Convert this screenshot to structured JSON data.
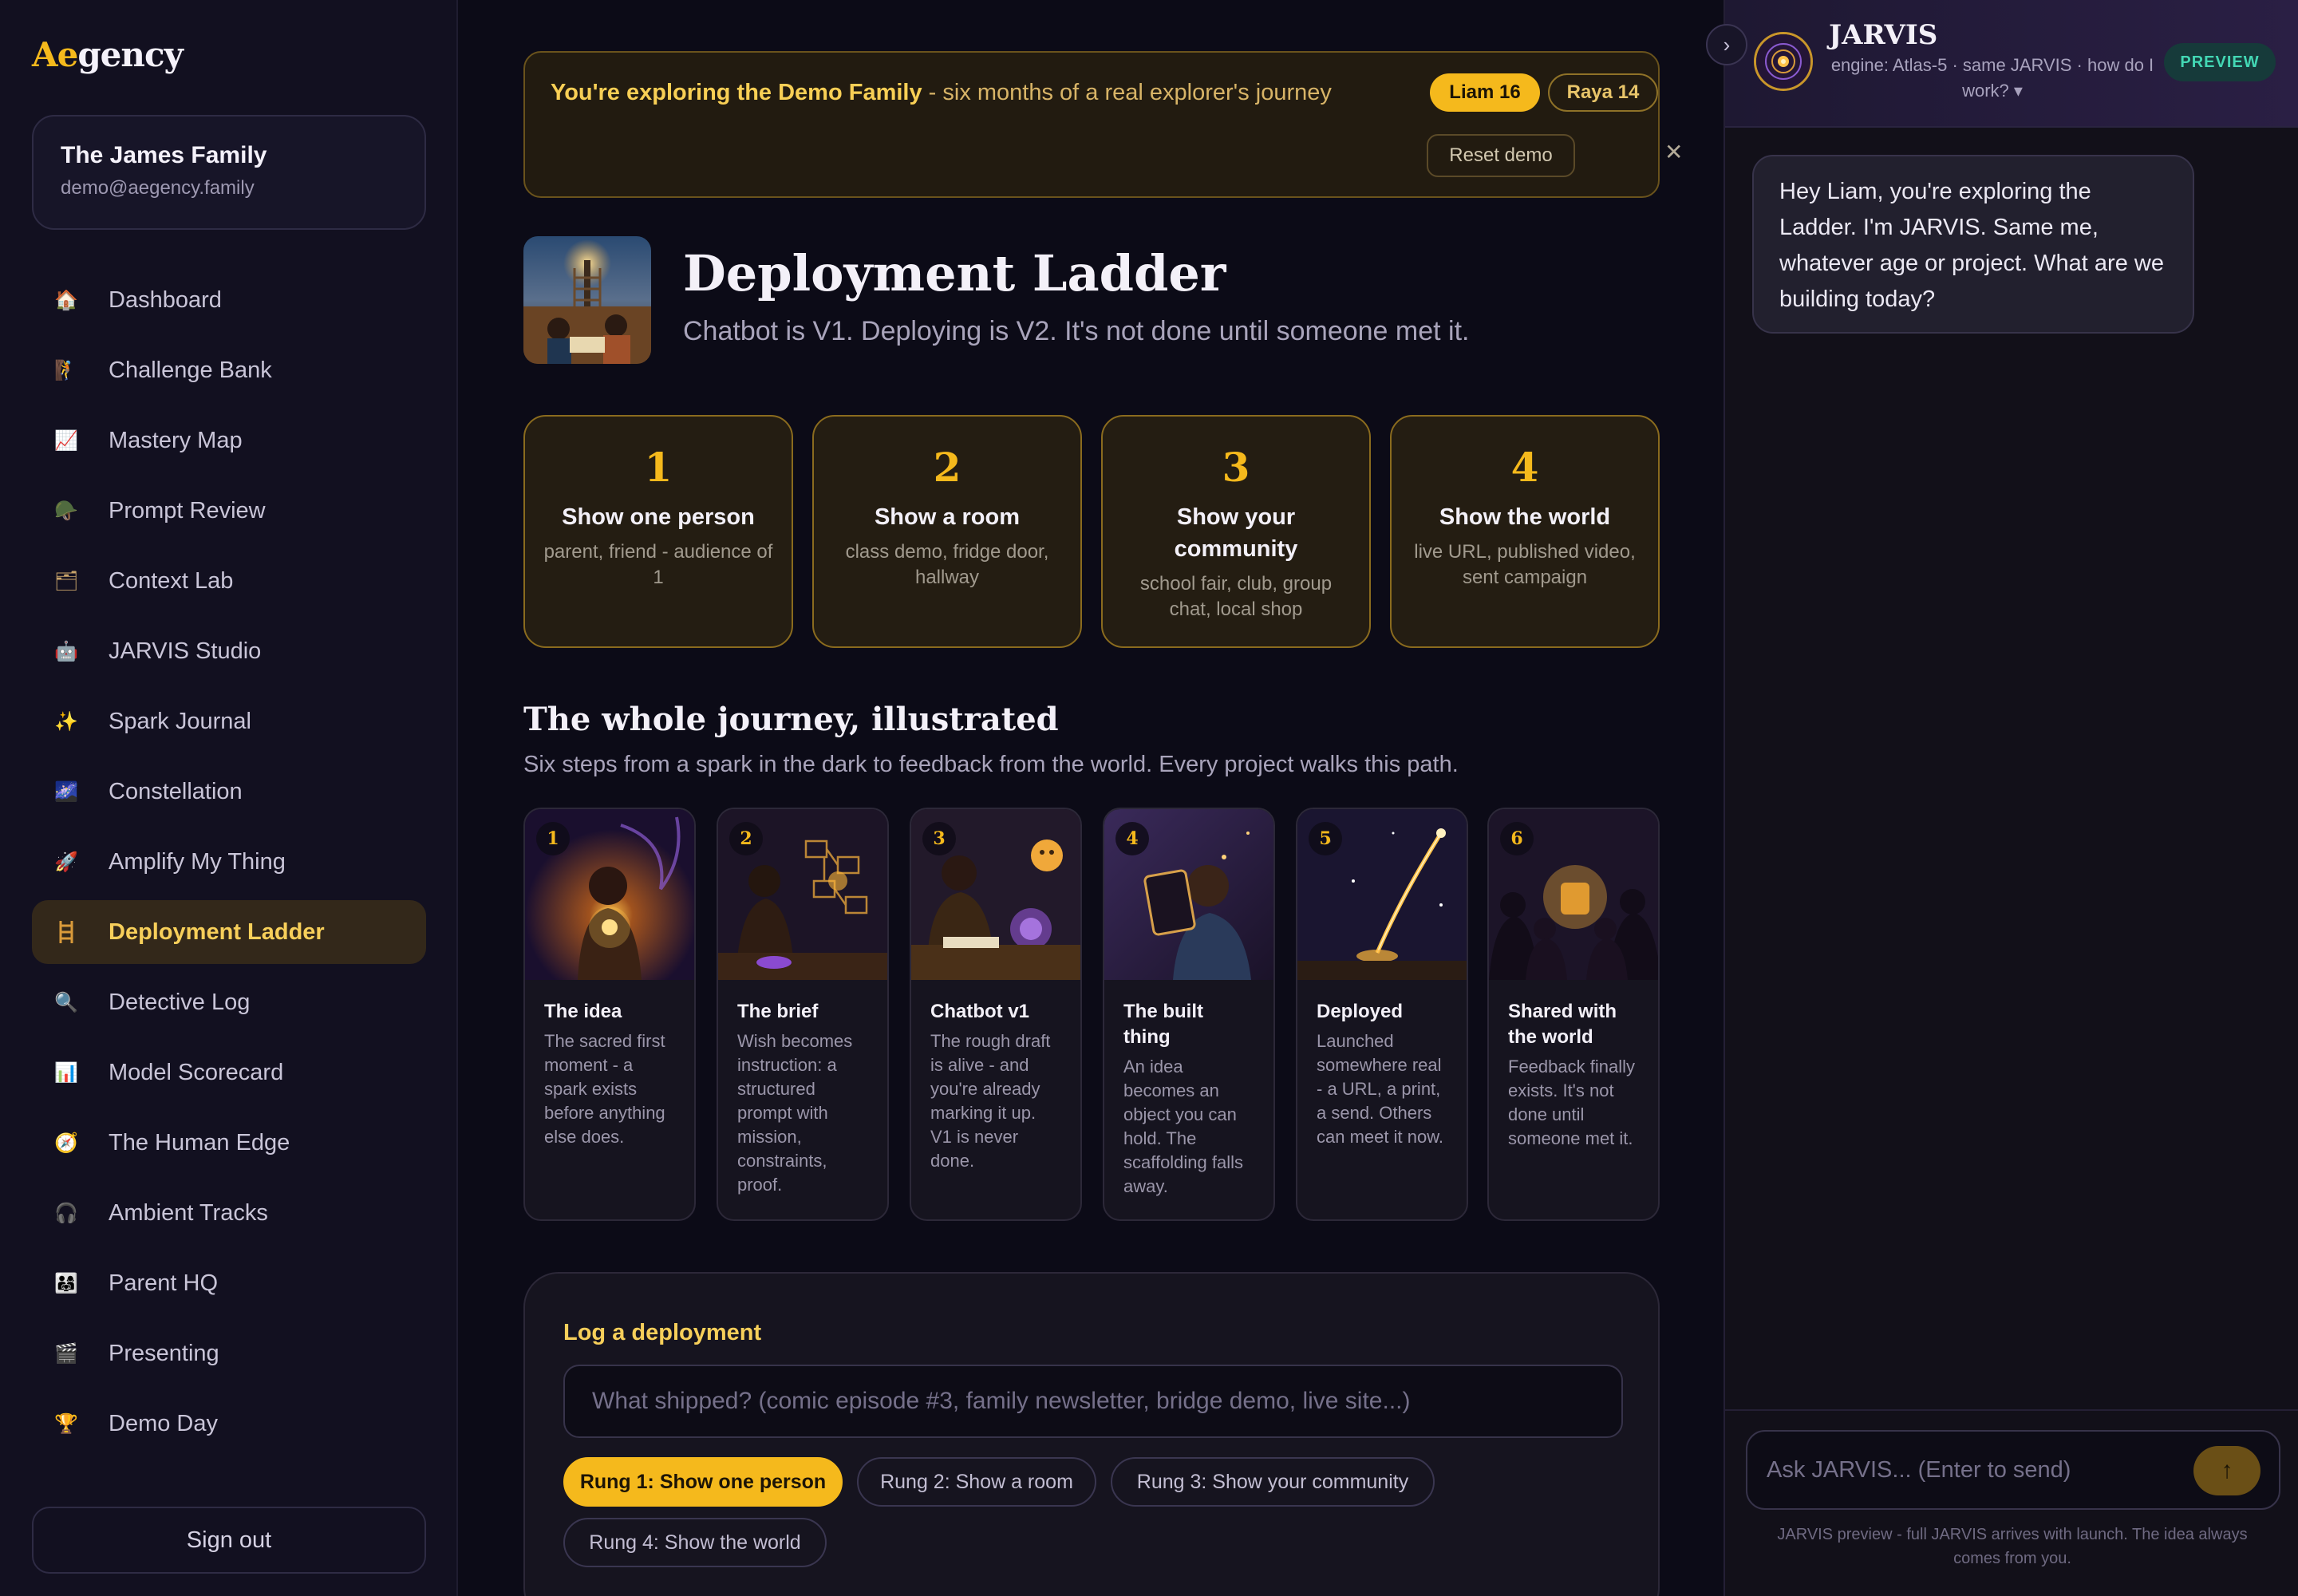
{
  "logo": {
    "accent": "Ae",
    "rest": "gency"
  },
  "family": {
    "name": "The James Family",
    "email": "demo@aegency.family"
  },
  "nav": [
    {
      "label": "Dashboard",
      "icon": "house-icon",
      "glyph": "🏠",
      "active": false
    },
    {
      "label": "Challenge Bank",
      "icon": "climber-icon",
      "glyph": "🧗",
      "active": false
    },
    {
      "label": "Mastery Map",
      "icon": "chart-up-icon",
      "glyph": "📈",
      "active": false
    },
    {
      "label": "Prompt Review",
      "icon": "helmet-icon",
      "glyph": "🪖",
      "active": false
    },
    {
      "label": "Context Lab",
      "icon": "folder-icon",
      "glyph": "🗂",
      "active": false
    },
    {
      "label": "JARVIS Studio",
      "icon": "robot-icon",
      "glyph": "🤖",
      "active": false
    },
    {
      "label": "Spark Journal",
      "icon": "sparkles-icon",
      "glyph": "✨",
      "active": false
    },
    {
      "label": "Constellation",
      "icon": "galaxy-icon",
      "glyph": "🌌",
      "active": false
    },
    {
      "label": "Amplify My Thing",
      "icon": "rocket-icon",
      "glyph": "🚀",
      "active": false
    },
    {
      "label": "Deployment Ladder",
      "icon": "ladder-icon",
      "glyph": "🪜",
      "active": true
    },
    {
      "label": "Detective Log",
      "icon": "magnifier-icon",
      "glyph": "🔍",
      "active": false
    },
    {
      "label": "Model Scorecard",
      "icon": "bar-chart-icon",
      "glyph": "📊",
      "active": false
    },
    {
      "label": "The Human Edge",
      "icon": "compass-icon",
      "glyph": "🧭",
      "active": false
    },
    {
      "label": "Ambient Tracks",
      "icon": "headphones-icon",
      "glyph": "🎧",
      "active": false
    },
    {
      "label": "Parent HQ",
      "icon": "family-icon",
      "glyph": "👨‍👩‍👧",
      "active": false
    },
    {
      "label": "Presenting",
      "icon": "clapperboard-icon",
      "glyph": "🎬",
      "active": false
    },
    {
      "label": "Demo Day",
      "icon": "trophy-icon",
      "glyph": "🏆",
      "active": false
    }
  ],
  "signout_label": "Sign out",
  "banner": {
    "bold": "You're exploring the Demo Family",
    "rest": " - six months of a real explorer's journey",
    "pill_liam": "Liam 16",
    "pill_raya": "Raya 14",
    "reset_label": "Reset demo",
    "close_glyph": "✕"
  },
  "page": {
    "title": "Deployment Ladder",
    "subtitle": "Chatbot is V1. Deploying is V2. It's not done until someone met it."
  },
  "rungs": [
    {
      "num": "1",
      "title": "Show one person",
      "desc": "parent, friend - audience of 1"
    },
    {
      "num": "2",
      "title": "Show a room",
      "desc": "class demo, fridge door, hallway"
    },
    {
      "num": "3",
      "title": "Show your community",
      "desc": "school fair, club, group chat, local shop"
    },
    {
      "num": "4",
      "title": "Show the world",
      "desc": "live URL, published video, sent campaign"
    }
  ],
  "journey": {
    "title": "The whole journey, illustrated",
    "subtitle": "Six steps from a spark in the dark to feedback from the world. Every project walks this path.",
    "steps": [
      {
        "num": "1",
        "title": "The idea",
        "desc": "The sacred first moment - a spark exists before anything else does."
      },
      {
        "num": "2",
        "title": "The brief",
        "desc": "Wish becomes instruction: a structured prompt with mission, constraints, proof."
      },
      {
        "num": "3",
        "title": "Chatbot v1",
        "desc": "The rough draft is alive - and you're already marking it up. V1 is never done."
      },
      {
        "num": "4",
        "title": "The built thing",
        "desc": "An idea becomes an object you can hold. The scaffolding falls away."
      },
      {
        "num": "5",
        "title": "Deployed",
        "desc": "Launched somewhere real - a URL, a print, a send. Others can meet it now."
      },
      {
        "num": "6",
        "title": "Shared with the world",
        "desc": "Feedback finally exists. It's not done until someone met it."
      }
    ]
  },
  "log": {
    "title": "Log a deployment",
    "placeholder": "What shipped? (comic episode #3, family newsletter, bridge demo, live site...)",
    "chips": [
      {
        "label": "Rung 1: Show one person",
        "active": true
      },
      {
        "label": "Rung 2: Show a room",
        "active": false
      },
      {
        "label": "Rung 3: Show your community",
        "active": false
      },
      {
        "label": "Rung 4: Show the world",
        "active": false
      }
    ]
  },
  "jarvis": {
    "name": "JARVIS",
    "engine": "engine: Atlas-5 · same JARVIS · how do I work? ▾",
    "badge": "PREVIEW",
    "collapse_glyph": "›",
    "message": "Hey Liam, you're exploring the Ladder. I'm JARVIS. Same me, whatever age or project. What are we building today?",
    "input_placeholder": "Ask JARVIS... (Enter to send)",
    "send_glyph": "↑",
    "note": "JARVIS preview - full JARVIS arrives with launch. The idea always comes from you."
  },
  "colors": {
    "accent": "#f5b91c",
    "background": "#0c0b17",
    "preview": "#43d7b4"
  }
}
